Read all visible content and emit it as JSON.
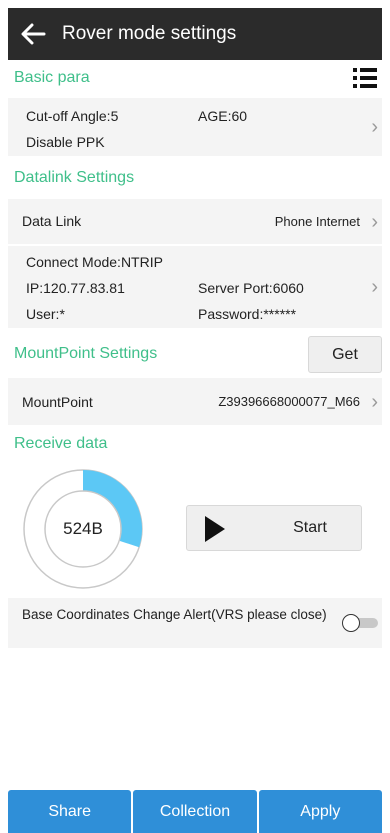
{
  "header": {
    "title": "Rover mode settings",
    "back_icon": "back-arrow-icon"
  },
  "sections": {
    "basic": "Basic para",
    "datalink": "Datalink Settings",
    "mountpoint": "MountPoint Settings",
    "receive": "Receive data"
  },
  "basic": {
    "cutoff": "Cut-off Angle:5",
    "age": "AGE:60",
    "ppk": "Disable PPK"
  },
  "datalink": {
    "label": "Data Link",
    "value": "Phone Internet"
  },
  "ntrip": {
    "mode": "Connect Mode:NTRIP",
    "ip": "IP:120.77.83.81",
    "port": "Server Port:6060",
    "user": "User:*",
    "password": "Password:******"
  },
  "mountpoint": {
    "get_label": "Get",
    "label": "MountPoint",
    "value": "Z39396668000077_M66"
  },
  "receive": {
    "amount": "524B",
    "start_label": "Start",
    "ring_fill_fraction": 0.3
  },
  "alert": {
    "text": "Base Coordinates Change Alert(VRS please close)",
    "enabled": false
  },
  "bottom": {
    "share": "Share",
    "collection": "Collection",
    "apply": "Apply"
  },
  "colors": {
    "accent": "#3fbf8a",
    "gauge": "#5cc8f5",
    "button": "#2f8fd8",
    "topbar": "#2b2b2b"
  },
  "chevron": "›"
}
